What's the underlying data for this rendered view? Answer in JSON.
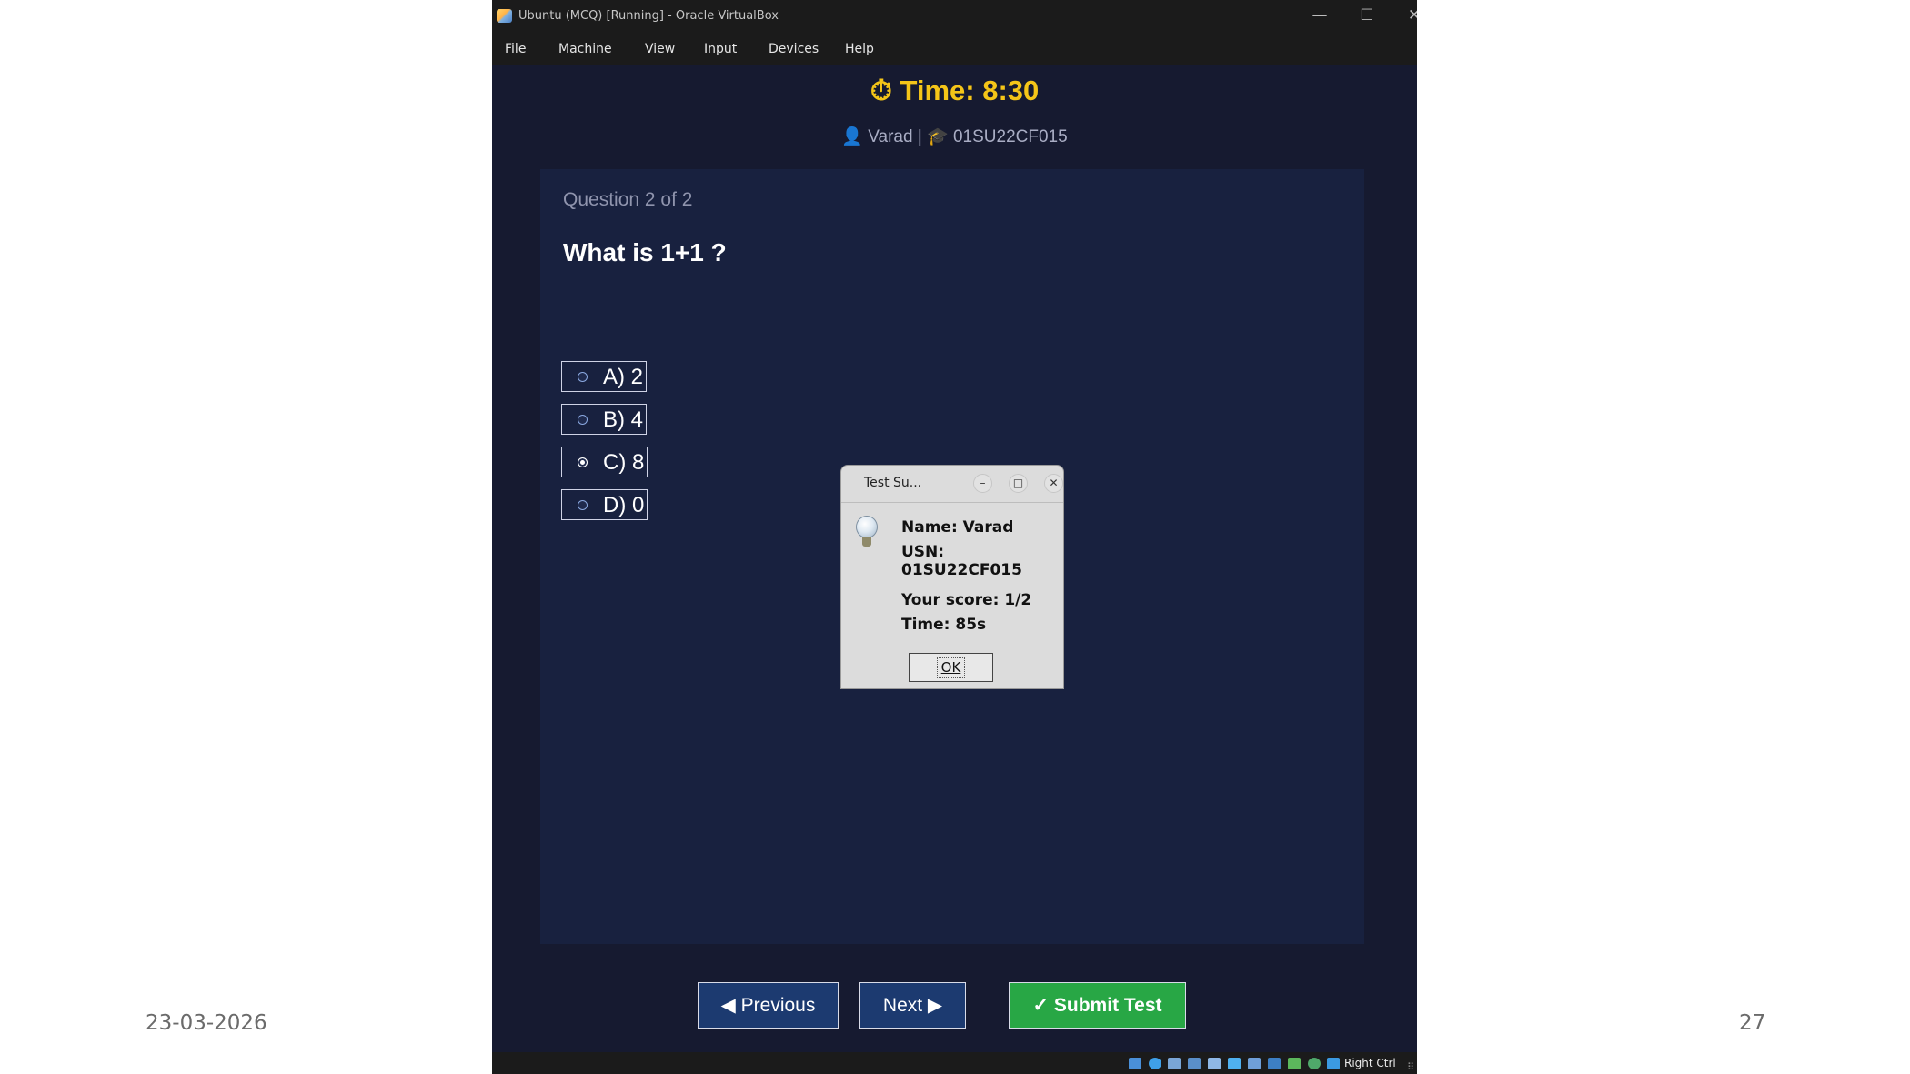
{
  "slide": {
    "date": "23-03-2026",
    "page_number": "27"
  },
  "window": {
    "title": "Ubuntu (MCQ) [Running] - Oracle VirtualBox",
    "controls": {
      "minimize": "—",
      "maximize": "☐",
      "close": "✕"
    },
    "menu": [
      "File",
      "Machine",
      "View",
      "Input",
      "Devices",
      "Help"
    ],
    "status_host_key": "Right Ctrl",
    "status_grip": "⠿"
  },
  "app": {
    "timer": "⏱ Time: 8:30",
    "user_line": "👤 Varad | 🎓 01SU22CF015",
    "question_counter": "Question 2 of 2",
    "question_text": "What is 1+1 ?",
    "options": [
      {
        "label": "A) 2",
        "selected": false
      },
      {
        "label": "B) 4",
        "selected": false
      },
      {
        "label": "C) 8",
        "selected": true
      },
      {
        "label": "D) 0",
        "selected": false
      }
    ],
    "buttons": {
      "previous": "◀ Previous",
      "next": "Next ▶",
      "submit": "✓ Submit Test"
    },
    "colors": {
      "background": "#161a30",
      "card": "#18213f",
      "timer": "#f5c518",
      "nav_button": "#1c3a70",
      "submit_button": "#28a745"
    }
  },
  "dialog": {
    "title": "Test Su...",
    "controls": {
      "minimize": "–",
      "maximize": "□",
      "close": "✕"
    },
    "name_line": "Name: Varad",
    "usn_line": "USN: 01SU22CF015",
    "score_line": "Your score: 1/2",
    "time_line": "Time: 85s",
    "ok_label": "OK"
  }
}
